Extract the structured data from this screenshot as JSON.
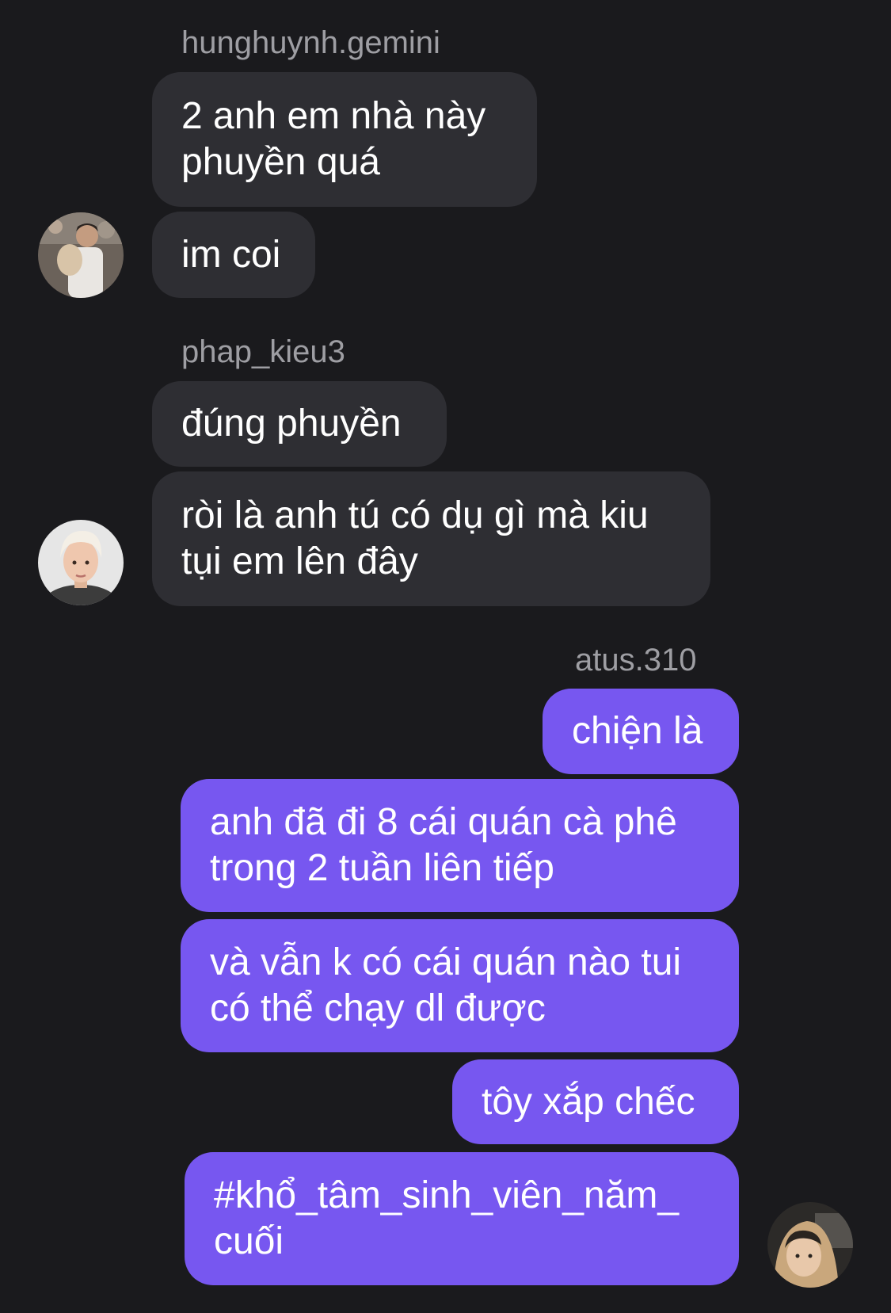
{
  "thread": {
    "groups": [
      {
        "sender": "hunghuynh.gemini",
        "avatar_icon": "user-avatar-icon",
        "messages": [
          "2 anh em nhà này\nphuyền quá",
          "im coi"
        ]
      },
      {
        "sender": "phap_kieu3",
        "avatar_icon": "user-avatar-icon",
        "messages": [
          "đúng phuyền",
          "ròi là anh tú có dụ gì mà kiu\ntụi em lên đây"
        ]
      },
      {
        "sender": "atus.310",
        "avatar_icon": "user-avatar-icon",
        "messages": [
          "chiện là",
          "anh đã đi 8 cái quán cà phê\ntrong 2 tuần liên tiếp",
          "và vẫn k có cái quán nào tui\ncó thể chạy dl được",
          "tôy xắp chếc",
          "#khổ_tâm_sinh_viên_năm_\ncuối"
        ]
      }
    ]
  },
  "colors": {
    "background": "#1a1a1d",
    "incoming_bubble": "#2e2e33",
    "outgoing_bubble": "#7757f0",
    "sender_name": "#9e9ea3"
  }
}
